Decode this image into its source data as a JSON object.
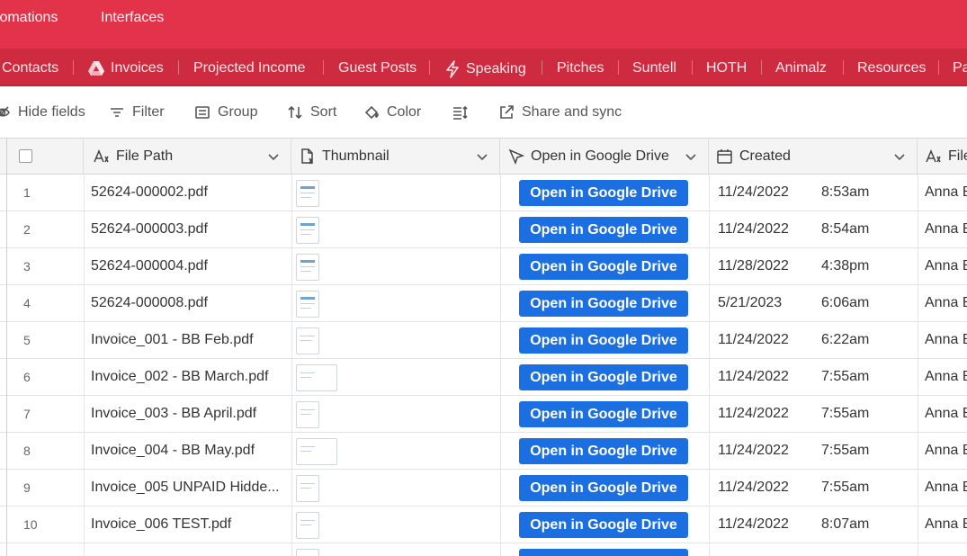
{
  "topnav": {
    "automations": "tomations",
    "interfaces": "Interfaces"
  },
  "tabs": [
    {
      "label": "Contacts",
      "icon": ""
    },
    {
      "label": "Invoices",
      "icon": "google-drive-icon"
    },
    {
      "label": "Projected Income",
      "icon": ""
    },
    {
      "label": "Guest Posts",
      "icon": ""
    },
    {
      "label": "Speaking",
      "icon": "lightning-icon"
    },
    {
      "label": "Pitches",
      "icon": ""
    },
    {
      "label": "Suntell",
      "icon": ""
    },
    {
      "label": "HOTH",
      "icon": ""
    },
    {
      "label": "Animalz",
      "icon": ""
    },
    {
      "label": "Resources",
      "icon": ""
    },
    {
      "label": "Pa",
      "icon": ""
    }
  ],
  "toolbar": {
    "hide_fields": "Hide fields",
    "filter": "Filter",
    "group": "Group",
    "sort": "Sort",
    "color": "Color",
    "share": "Share and sync"
  },
  "columns": {
    "file_path": "File Path",
    "thumbnail": "Thumbnail",
    "open_drive": "Open in Google Drive",
    "created": "Created",
    "file_owner": "File"
  },
  "rows": [
    {
      "num": "1",
      "file": "52624-000002.pdf",
      "button": "Open in Google Drive",
      "date": "11/24/2022",
      "time": "8:53am",
      "owner": "Anna B",
      "thumb": "doc"
    },
    {
      "num": "2",
      "file": "52624-000003.pdf",
      "button": "Open in Google Drive",
      "date": "11/24/2022",
      "time": "8:54am",
      "owner": "Anna B",
      "thumb": "doc"
    },
    {
      "num": "3",
      "file": "52624-000004.pdf",
      "button": "Open in Google Drive",
      "date": "11/28/2022",
      "time": "4:38pm",
      "owner": "Anna B",
      "thumb": "doc"
    },
    {
      "num": "4",
      "file": "52624-000008.pdf",
      "button": "Open in Google Drive",
      "date": "5/21/2023",
      "time": "6:06am",
      "owner": "Anna B",
      "thumb": "doc"
    },
    {
      "num": "5",
      "file": "Invoice_001 - BB Feb.pdf",
      "button": "Open in Google Drive",
      "date": "11/24/2022",
      "time": "6:22am",
      "owner": "Anna B",
      "thumb": "plain"
    },
    {
      "num": "6",
      "file": "Invoice_002 - BB March.pdf",
      "button": "Open in Google Drive",
      "date": "11/24/2022",
      "time": "7:55am",
      "owner": "Anna B",
      "thumb": "wide"
    },
    {
      "num": "7",
      "file": "Invoice_003 - BB April.pdf",
      "button": "Open in Google Drive",
      "date": "11/24/2022",
      "time": "7:55am",
      "owner": "Anna B",
      "thumb": "plain"
    },
    {
      "num": "8",
      "file": "Invoice_004 - BB May.pdf",
      "button": "Open in Google Drive",
      "date": "11/24/2022",
      "time": "7:55am",
      "owner": "Anna B",
      "thumb": "wide"
    },
    {
      "num": "9",
      "file": "Invoice_005 UNPAID Hidde...",
      "button": "Open in Google Drive",
      "date": "11/24/2022",
      "time": "7:55am",
      "owner": "Anna B",
      "thumb": "plain"
    },
    {
      "num": "10",
      "file": "Invoice_006 TEST.pdf",
      "button": "Open in Google Drive",
      "date": "11/24/2022",
      "time": "8:07am",
      "owner": "Anna B",
      "thumb": "plain"
    },
    {
      "num": "",
      "file": "",
      "button": "",
      "date": "",
      "time": "",
      "owner": "",
      "thumb": "plain"
    }
  ],
  "colors": {
    "topbar": "#e3334a",
    "tabbar": "#cf2b40",
    "button": "#1c6fe0"
  }
}
